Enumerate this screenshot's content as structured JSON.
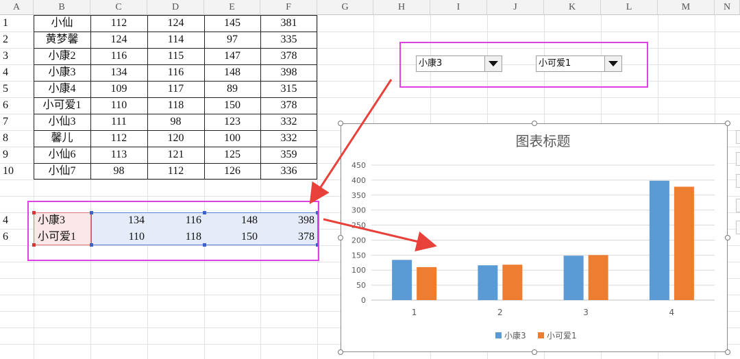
{
  "spreadsheet": {
    "column_headers": [
      "A",
      "B",
      "C",
      "D",
      "E",
      "F",
      "G",
      "H",
      "I",
      "J",
      "K",
      "L",
      "M",
      "N"
    ],
    "rows": [
      [
        "1",
        "小仙",
        "112",
        "124",
        "145",
        "381"
      ],
      [
        "2",
        "黄梦馨",
        "124",
        "114",
        "97",
        "335"
      ],
      [
        "3",
        "小康2",
        "116",
        "115",
        "147",
        "378"
      ],
      [
        "4",
        "小康3",
        "134",
        "116",
        "148",
        "398"
      ],
      [
        "5",
        "小康4",
        "109",
        "117",
        "89",
        "315"
      ],
      [
        "6",
        "小可爱1",
        "110",
        "118",
        "150",
        "378"
      ],
      [
        "7",
        "小仙3",
        "111",
        "98",
        "123",
        "332"
      ],
      [
        "8",
        "馨儿",
        "112",
        "120",
        "100",
        "332"
      ],
      [
        "9",
        "小仙6",
        "113",
        "121",
        "125",
        "359"
      ],
      [
        "10",
        "小仙7",
        "98",
        "112",
        "126",
        "336"
      ]
    ],
    "lookup_rows": [
      [
        "4",
        "小康3",
        "134",
        "116",
        "148",
        "398"
      ],
      [
        "6",
        "小可爱1",
        "110",
        "118",
        "150",
        "378"
      ]
    ]
  },
  "dropdowns": {
    "first": {
      "value": "小康3"
    },
    "second": {
      "value": "小可爱1"
    }
  },
  "chart_data": {
    "type": "bar",
    "title": "图表标题",
    "categories": [
      "1",
      "2",
      "3",
      "4"
    ],
    "series": [
      {
        "name": "小康3",
        "values": [
          134,
          116,
          148,
          398
        ],
        "color": "#5b9bd5"
      },
      {
        "name": "小可爱1",
        "values": [
          110,
          118,
          150,
          378
        ],
        "color": "#ed7d31"
      }
    ],
    "ylim": [
      0,
      450
    ],
    "yticks": [
      0,
      50,
      100,
      150,
      200,
      250,
      300,
      350,
      400,
      450
    ],
    "grid": true,
    "legend": "bottom"
  },
  "colors": {
    "annotation_border": "#e040e0",
    "arrow": "#e8413a"
  }
}
